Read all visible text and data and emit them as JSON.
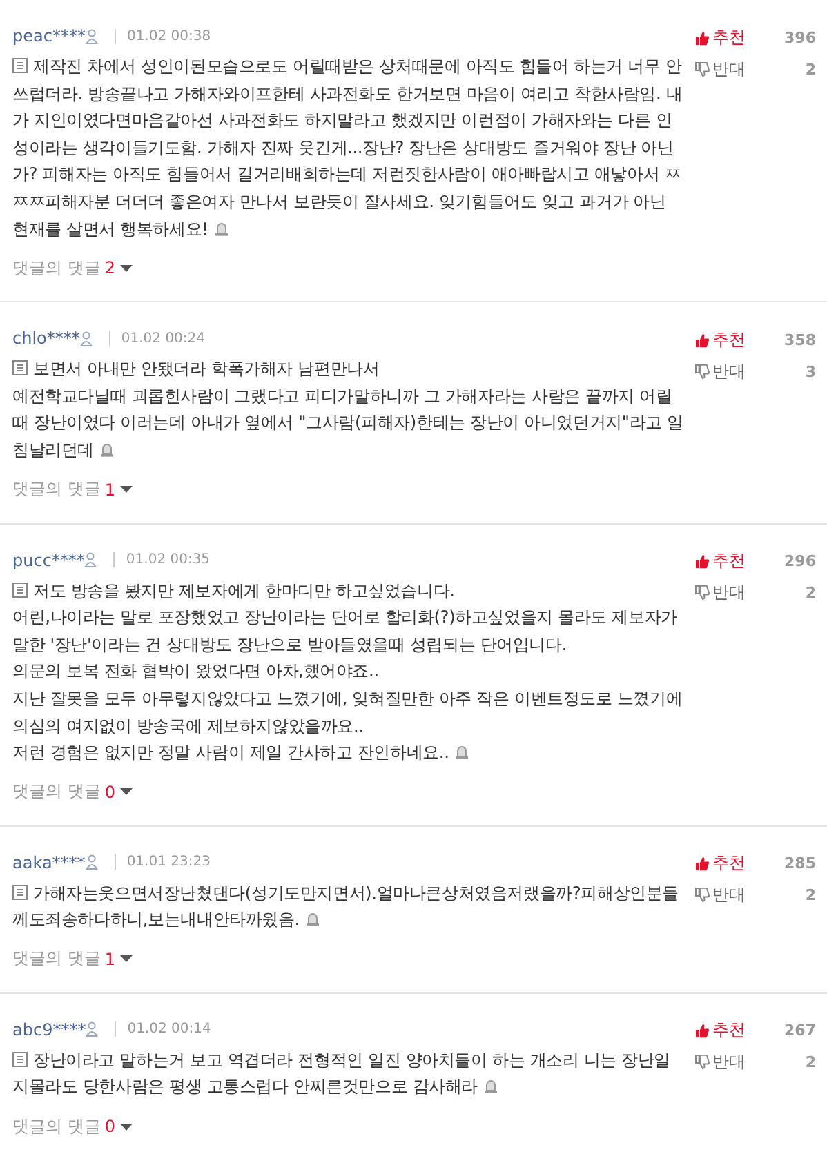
{
  "comments": [
    {
      "author": "peac****",
      "date": "01.02 00:38",
      "text": "제작진 차에서 성인이된모습으로도 어릴때받은 상처때문에 아직도 힘들어 하는거 너무 안쓰럽더라. 방송끝나고 가해자와이프한테 사과전화도 한거보면 마음이 여리고 착한사람임. 내가 지인이였다면마음같아선 사과전화도 하지말라고 했겠지만 이런점이 가해자와는 다른 인성이라는 생각이들기도함. 가해자 진짜 웃긴게...장난? 장난은 상대방도 즐거워야 장난 아닌가? 피해자는 아직도 힘들어서 길거리배회하는데 저런짓한사람이 애아빠랍시고 애낳아서 ㅉㅉㅉ피해자분 더더더 좋은여자 만나서 보란듯이 잘사세요. 잊기힘들어도 잊고 과거가 아닌 현재를 살면서 행복하세요!",
      "like_label": "추천",
      "likes": "396",
      "dislike_label": "반대",
      "dislikes": "2",
      "replies_label": "댓글의 댓글",
      "replies": "2"
    },
    {
      "author": "chlo****",
      "date": "01.02 00:24",
      "text": "보면서 아내만 안됐더라 학폭가해자 남편만나서\n예전학교다닐때 괴롭힌사람이 그랬다고 피디가말하니까 그 가해자라는 사람은 끝까지 어릴때 장난이였다 이러는데 아내가 옆에서 \"그사람(피해자)한테는 장난이 아니었던거지\"라고 일침날리던데",
      "like_label": "추천",
      "likes": "358",
      "dislike_label": "반대",
      "dislikes": "3",
      "replies_label": "댓글의 댓글",
      "replies": "1"
    },
    {
      "author": "pucc****",
      "date": "01.02 00:35",
      "text": "저도 방송을 봤지만 제보자에게 한마디만 하고싶었습니다.\n어린,나이라는 말로 포장했었고 장난이라는 단어로 합리화(?)하고싶었을지 몰라도 제보자가 말한 '장난'이라는 건 상대방도 장난으로 받아들였을때 성립되는 단어입니다.\n의문의 보복 전화 협박이 왔었다면 아차,했어야죠..\n지난 잘못을 모두 아무렇지않았다고 느꼈기에, 잊혀질만한 아주 작은 이벤트정도로 느꼈기에 의심의 여지없이 방송국에 제보하지않았을까요..\n저런 경험은 없지만 정말 사람이 제일 간사하고 잔인하네요..",
      "like_label": "추천",
      "likes": "296",
      "dislike_label": "반대",
      "dislikes": "2",
      "replies_label": "댓글의 댓글",
      "replies": "0"
    },
    {
      "author": "aaka****",
      "date": "01.01 23:23",
      "text": "가해자는웃으면서장난쳤댄다(성기도만지면서).얼마나큰상처였음저랬을까?피해상인분들께도죄송하다하니,보는내내안타까웠음.",
      "like_label": "추천",
      "likes": "285",
      "dislike_label": "반대",
      "dislikes": "2",
      "replies_label": "댓글의 댓글",
      "replies": "1"
    },
    {
      "author": "abc9****",
      "date": "01.02 00:14",
      "text": "장난이라고 말하는거 보고 역겹더라 전형적인 일진 양아치들이 하는 개소리 니는 장난일지몰라도 당한사람은 평생 고통스럽다 안찌른것만으로 감사해라",
      "like_label": "추천",
      "likes": "267",
      "dislike_label": "반대",
      "dislikes": "2",
      "replies_label": "댓글의 댓글",
      "replies": "0"
    }
  ]
}
